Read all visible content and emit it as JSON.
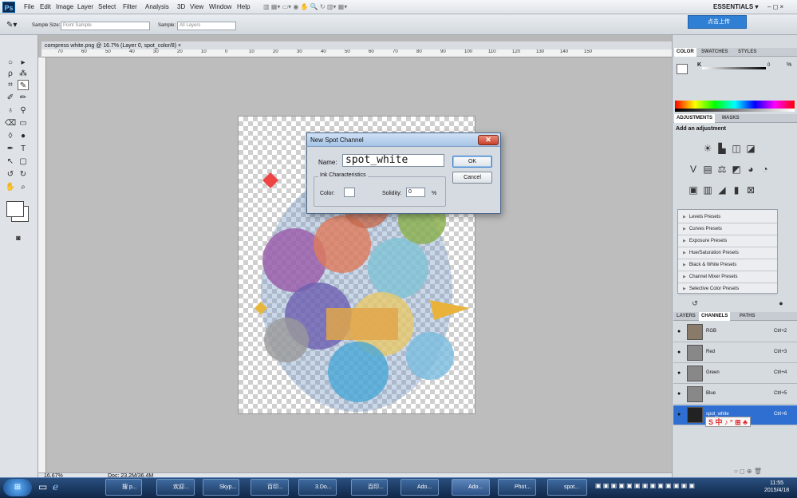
{
  "menubar": {
    "logo": "Ps",
    "items": [
      "File",
      "Edit",
      "Image",
      "Layer",
      "Select",
      "Filter",
      "Analysis",
      "3D",
      "View",
      "Window",
      "Help"
    ],
    "workspace": "ESSENTIALS ▾",
    "window_controls": "– ◻ ×"
  },
  "options": {
    "sample_size_label": "Sample Size:",
    "sample_size_value": "Point Sample",
    "sample_label": "Sample:",
    "sample_value": "All Layers",
    "weibo_button": "点击上传"
  },
  "document": {
    "tab_title": "compress white.png @ 16.7% (Layer 0, spot_color/8) ×",
    "ruler_ticks": [
      "70",
      "60",
      "50",
      "40",
      "30",
      "20",
      "10",
      "0",
      "10",
      "20",
      "30",
      "40",
      "50",
      "60",
      "70",
      "80",
      "90",
      "100",
      "110",
      "120",
      "130",
      "140",
      "150"
    ]
  },
  "status": {
    "zoom": "16.67%",
    "doc_size": "Doc: 23.2M/36.4M"
  },
  "dialog": {
    "title": "New Spot Channel",
    "name_label": "Name:",
    "name_value": "spot_white",
    "ok_label": "OK",
    "cancel_label": "Cancel",
    "ink_legend": "Ink Characteristics",
    "color_label": "Color:",
    "solidity_label": "Solidity:",
    "solidity_value": "0",
    "percent": "%"
  },
  "color_panel": {
    "tabs": [
      "COLOR",
      "SWATCHES",
      "STYLES"
    ],
    "k_label": "K",
    "k_value": "0",
    "k_unit": "%"
  },
  "adjustments_panel": {
    "tabs": [
      "ADJUSTMENTS",
      "MASKS"
    ],
    "heading": "Add an adjustment",
    "presets": [
      "Levels Presets",
      "Curves Presets",
      "Exposure Presets",
      "Hue/Saturation Presets",
      "Black & White Presets",
      "Channel Mixer Presets",
      "Selective Color Presets"
    ]
  },
  "layers_panel": {
    "tabs": [
      "LAYERS",
      "CHANNELS",
      "PATHS"
    ],
    "channels": [
      {
        "name": "RGB",
        "key": "Ctrl+2"
      },
      {
        "name": "Red",
        "key": "Ctrl+3"
      },
      {
        "name": "Green",
        "key": "Ctrl+4"
      },
      {
        "name": "Blue",
        "key": "Ctrl+5"
      },
      {
        "name": "spot_white",
        "key": "Ctrl+6"
      }
    ]
  },
  "taskbar": {
    "buttons": [
      "搜 p...",
      "欢迎...",
      "Skyp...",
      "百印...",
      "3.Do...",
      "百印...",
      "Ado...",
      "Ado...",
      "Phot...",
      "spot..."
    ],
    "ime": "S 中 ♪ ° ⊞ ♣",
    "time": "11:55",
    "date": "2015/4/18"
  },
  "colors": {
    "accent": "#2f6fd1",
    "dialog_bg": "#d6dbe2",
    "taskbar": "#1c3a63"
  }
}
